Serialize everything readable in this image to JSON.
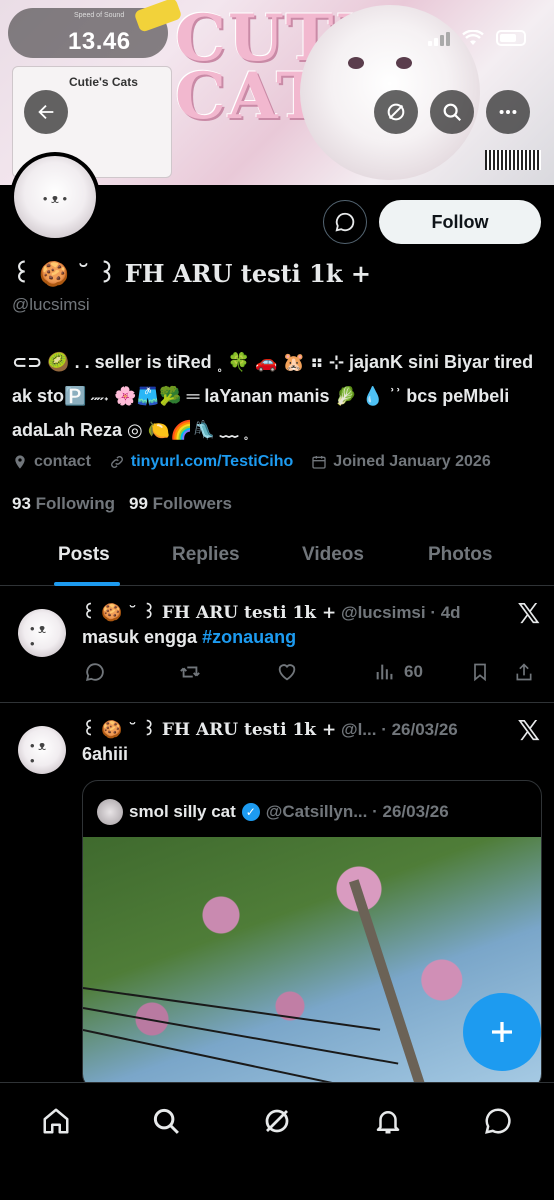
{
  "status_bar": {
    "time": "13.46"
  },
  "banner": {
    "art_title": "CUTIE CAT",
    "mini_card_title": "Cutie's Cats",
    "music_widget_label": "Speed of Sound"
  },
  "profile": {
    "display_name": "꒰ 🍪 ˘ ꒱ FH ARU testi 1k +",
    "handle": "@lucsimsi",
    "bio": "⊂⊃ 🥝 . . seller is tiRed ˳ 🍀 🚗 🐹 ⠶ ⊹ jajanK sini Biyar tired ak sto🅿️ ˶˶˖ 🌸🩳🥦 ═ laYanan manis 🥬 💧 ʾʾ bcs peMbeli adaLah Reza ◎ 🍋🌈🛝 ﹏ ˳",
    "contact_label": "contact",
    "link": "tinyurl.com/TestiCiho",
    "joined": "Joined January 2026",
    "following_count": "93",
    "following_label": "Following",
    "followers_count": "99",
    "followers_label": "Followers",
    "follow_button": "Follow"
  },
  "tabs": [
    "Posts",
    "Replies",
    "Videos",
    "Photos"
  ],
  "posts": [
    {
      "name": "꒰ 🍪 ˘ ꒱ FH ARU testi 1k +",
      "meta": "@lucsimsi · 4d",
      "text_prefix": "masuk engga",
      "hashtag": "#zonauang",
      "views": "60"
    },
    {
      "name": "꒰ 🍪 ˘ ꒱ FH ARU testi 1k +",
      "meta": "@l... · 26/03/26",
      "text": "6ahiii",
      "quote": {
        "name": "smol silly cat",
        "meta": "@Catsillyn... · 26/03/26"
      }
    }
  ],
  "icons": {
    "back": "arrow-left-icon",
    "grok": "grok-icon",
    "search": "search-icon",
    "more": "more-icon",
    "x_logo": "x-logo-icon"
  },
  "colors": {
    "accent": "#1d9bf0",
    "background": "#000000",
    "muted": "#71767b"
  }
}
